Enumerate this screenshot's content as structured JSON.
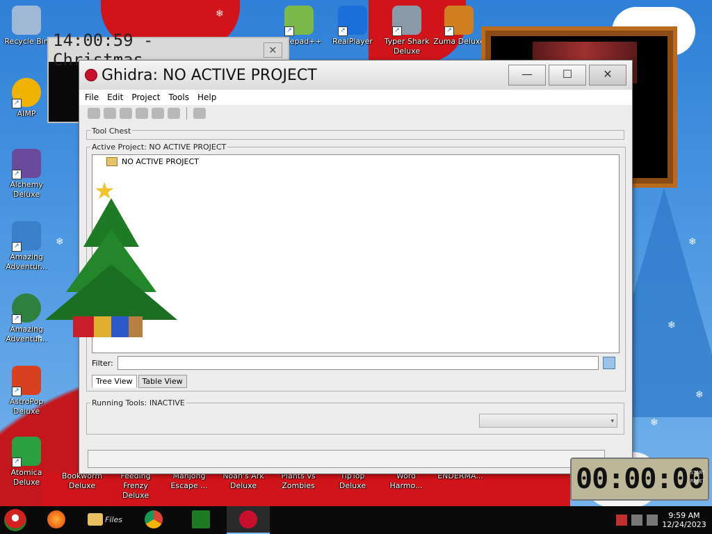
{
  "desktop": {
    "icons": [
      {
        "label": "Recycle Bin",
        "color": "#9fb8d6"
      },
      {
        "label": "AIMP",
        "color": "#f0b400"
      },
      {
        "label": "Alchemy Deluxe",
        "color": "#6a4a9a"
      },
      {
        "label": "Amazing Adventur...",
        "color": "#3a80c8"
      },
      {
        "label": "Amazing Adventur...",
        "color": "#2f7f40"
      },
      {
        "label": "AstroPop Deluxe",
        "color": "#d94020"
      },
      {
        "label": "Atomica Deluxe",
        "color": "#2aa040"
      },
      {
        "label": "Notepad++",
        "color": "#7ab84a"
      },
      {
        "label": "RealPlayer",
        "color": "#1a70d8"
      },
      {
        "label": "Typer Shark Deluxe",
        "color": "#8a9aa8"
      },
      {
        "label": "Zuma Deluxe",
        "color": "#d08020"
      },
      {
        "label": "Bookworm Deluxe",
        "color": "#8a6030"
      },
      {
        "label": "Feeding Frenzy Deluxe",
        "color": "#2080c0"
      },
      {
        "label": "Mahjong Escape ...",
        "color": "#408040"
      },
      {
        "label": "Noah's Ark Deluxe",
        "color": "#a08040"
      },
      {
        "label": "Plants vs Zombies",
        "color": "#40a040"
      },
      {
        "label": "TipTop Deluxe",
        "color": "#c04040"
      },
      {
        "label": "Word Harmo...",
        "color": "#6040a0"
      },
      {
        "label": "ENDERMA...",
        "color": "#404040"
      }
    ]
  },
  "clock_window": {
    "title": "14:00:59 - Christmas..."
  },
  "ghidra": {
    "title": "Ghidra: NO ACTIVE PROJECT",
    "menu": [
      "File",
      "Edit",
      "Project",
      "Tools",
      "Help"
    ],
    "tool_chest_label": "Tool Chest",
    "active_project_label": "Active Project: NO ACTIVE PROJECT",
    "tree_root": "NO ACTIVE PROJECT",
    "filter_label": "Filter:",
    "filter_value": "",
    "tabs": [
      "Tree View",
      "Table View"
    ],
    "active_tab": "Tree View",
    "running_tools_label": "Running Tools: INACTIVE",
    "combo_value": ""
  },
  "timer": {
    "value": "00:00:00",
    "side_top": "START",
    "side_bottom": "RESET"
  },
  "taskbar": {
    "time": "9:59 AM",
    "date": "12/24/2023",
    "files_label": "Files"
  },
  "colors": {
    "desktop_blue": "#2f7fd8",
    "accent_red": "#c4161c",
    "tree_green": "#1f7a26"
  }
}
